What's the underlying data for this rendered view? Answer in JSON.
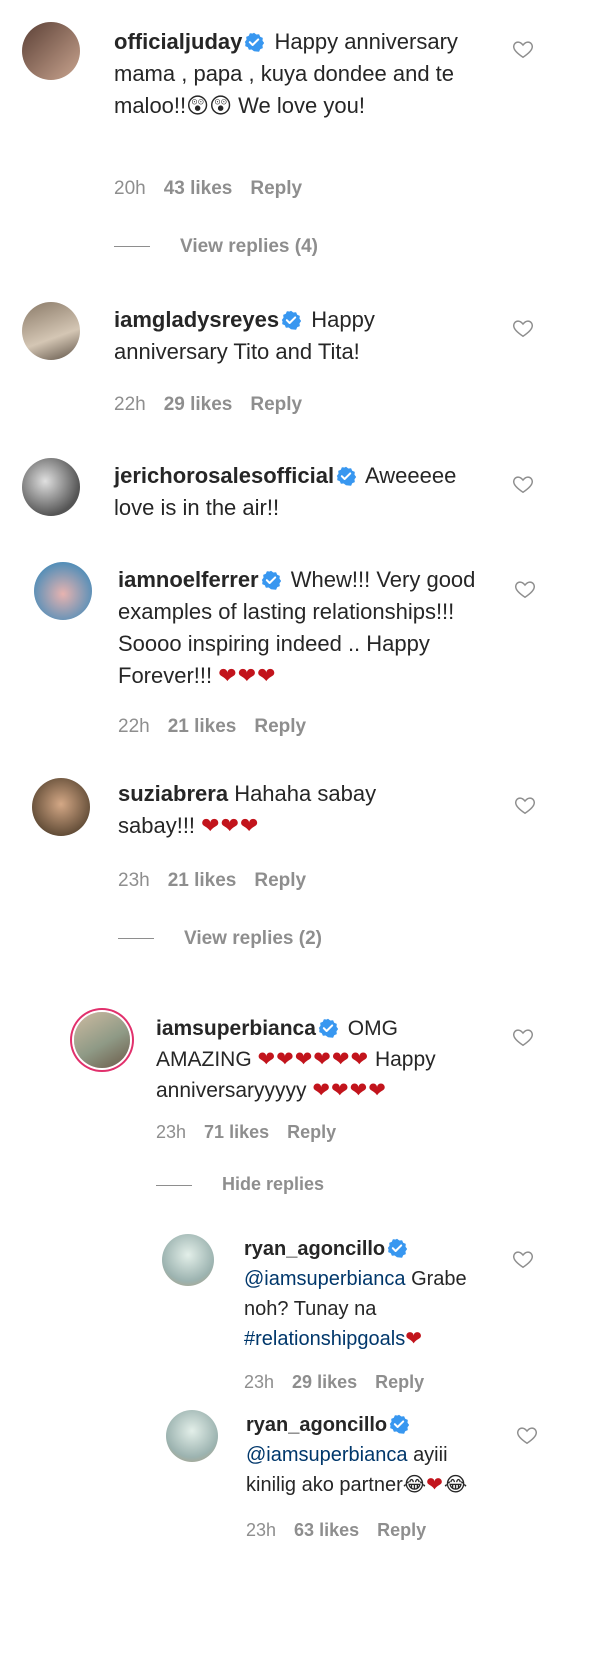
{
  "comments": [
    {
      "user": "officialjuday",
      "text": "Happy anniversary mama , papa , kuya dondee and te maloo!!",
      "emoji": "😲😲",
      "text2": "We love you!",
      "time": "20h",
      "likes": "43 likes",
      "reply": "Reply",
      "view_replies": "View replies (4)"
    },
    {
      "user": "iamgladysreyes",
      "text": "Happy anniversary Tito and Tita!",
      "time": "22h",
      "likes": "29 likes",
      "reply": "Reply"
    },
    {
      "user": "jerichorosalesofficial",
      "text": "Aweeeee love is in the air!!"
    },
    {
      "user": "iamnoelferrer",
      "text": "Whew!!! Very good examples of lasting relationships!!! Soooo inspiring indeed .. Happy Forever!!!",
      "hearts": "❤❤❤",
      "time": "22h",
      "likes": "21 likes",
      "reply": "Reply"
    },
    {
      "user": "suziabrera",
      "text": "Hahaha sabay sabay!!!",
      "hearts": "❤❤❤",
      "time": "23h",
      "likes": "21 likes",
      "reply": "Reply",
      "view_replies": "View replies (2)"
    },
    {
      "user": "iamsuperbianca",
      "text": "OMG AMAZING",
      "hearts": "❤❤❤❤❤❤",
      "text2": "Happy anniversaryyyyy",
      "hearts2": "❤❤❤❤",
      "time": "23h",
      "likes": "71 likes",
      "reply": "Reply",
      "hide_replies": "Hide replies"
    },
    {
      "user": "ryan_agoncillo",
      "mention": "@iamsuperbianca",
      "text": "Grabe noh? Tunay na",
      "tag": "#relationshipgoals",
      "hearts": "❤",
      "time": "23h",
      "likes": "29 likes",
      "reply": "Reply"
    },
    {
      "user": "ryan_agoncillo",
      "mention": "@iamsuperbianca",
      "text": "ayiii kinilig ako partner",
      "emoji": "😂",
      "hearts": "❤",
      "emoji2": "😂",
      "time": "23h",
      "likes": "63 likes",
      "reply": "Reply"
    }
  ],
  "colors": {
    "verified": "#3897f0",
    "heart": "#c2141c",
    "meta": "#8e8e8e",
    "link": "#00376b"
  },
  "icons": {
    "verified": "verified-badge-icon",
    "like": "heart-outline-icon"
  }
}
